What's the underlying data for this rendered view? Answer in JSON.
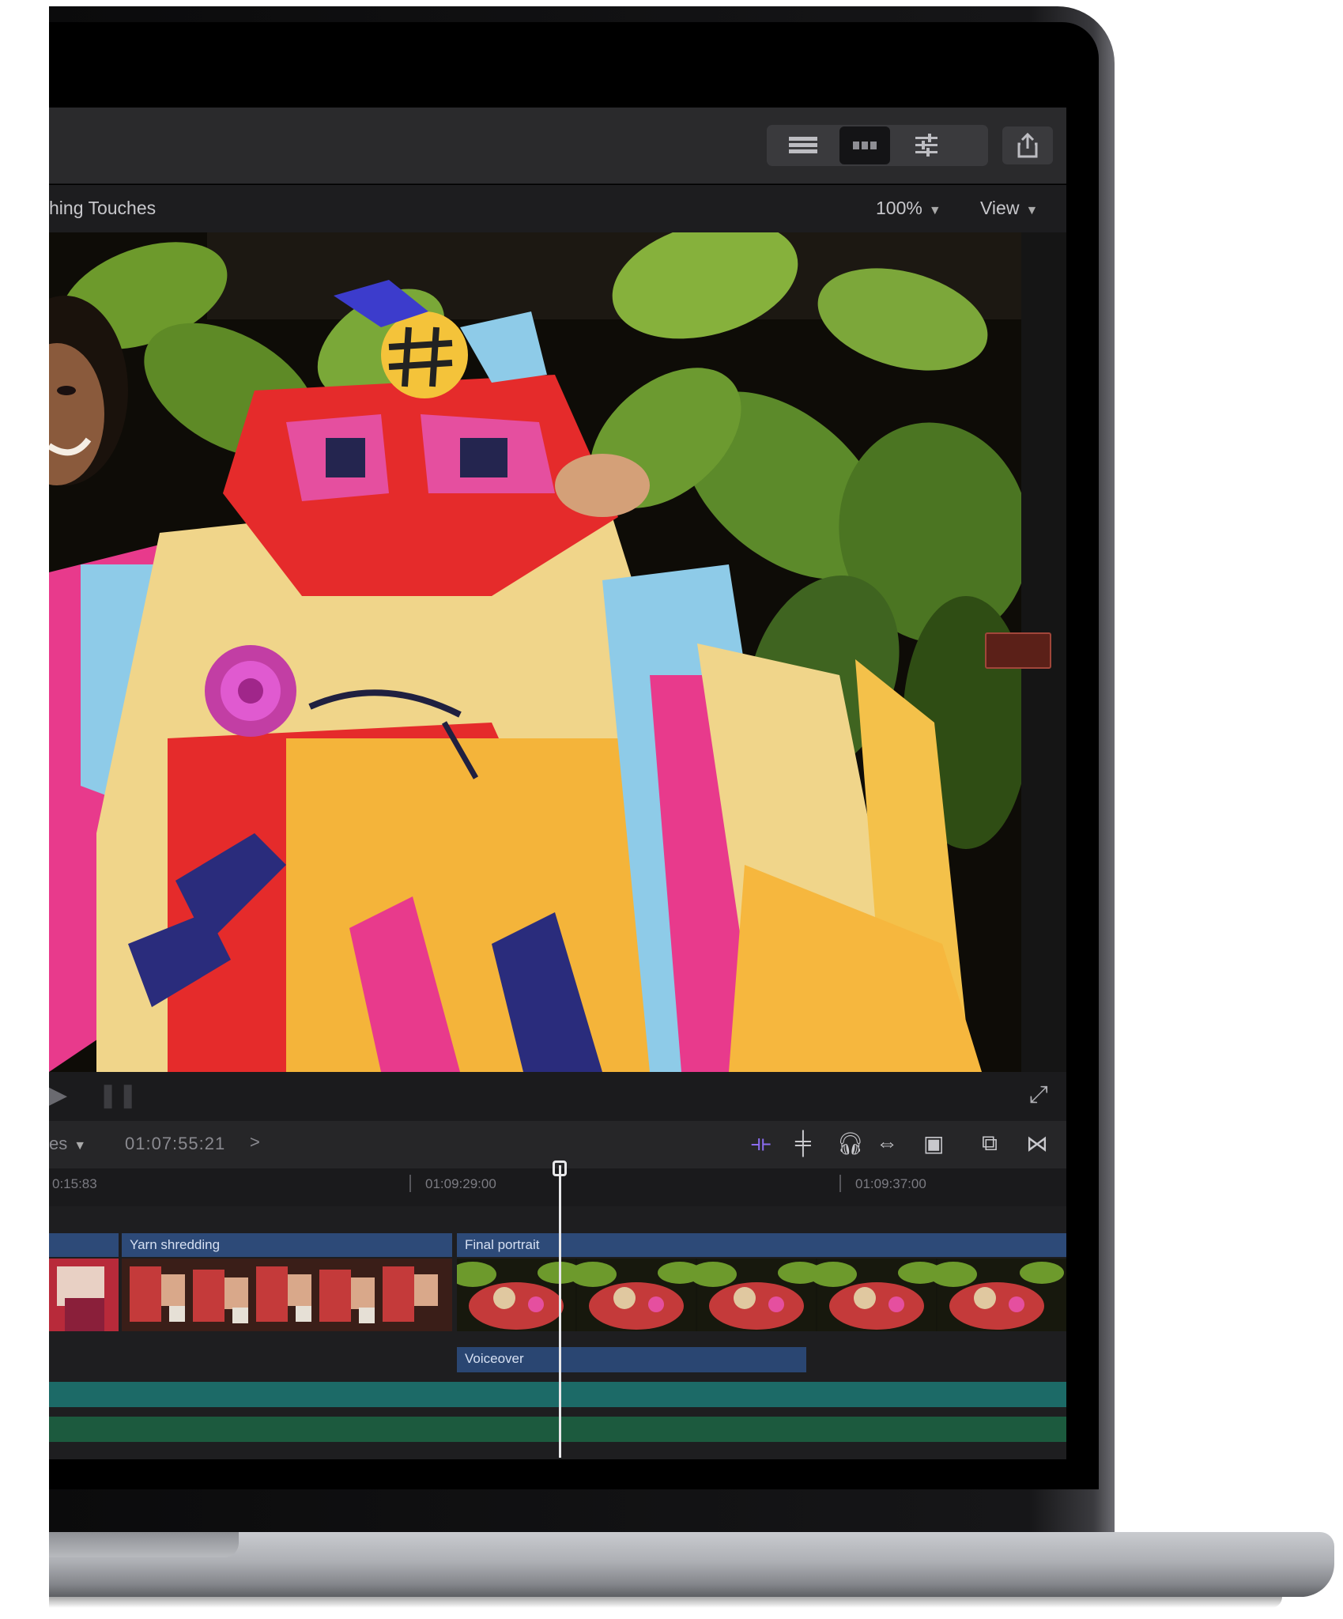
{
  "app": {
    "viewer": {
      "title": "hing Touches",
      "zoom_value": "100%",
      "view_menu_label": "View"
    },
    "timeline": {
      "project_label": "es",
      "timecode": "01:07:55:21",
      "ruler_labels": [
        "0:15:83",
        "01:09:29:00",
        "01:09:37:00"
      ],
      "clips": [
        {
          "title": "Yarn shredding"
        },
        {
          "title": "Final portrait"
        },
        {
          "title": "Voiceover"
        }
      ]
    }
  },
  "colors": {
    "clip_blue": "#2d4a78",
    "audio_teal": "#1c6a67",
    "audio_green": "#1c5a3e",
    "accent_purple": "#8b6cf0"
  },
  "icons": {
    "toolbar": [
      "list-view-icon",
      "filmstrip-view-icon",
      "inspector-sliders-icon",
      "share-icon"
    ],
    "timeline_tools": [
      "skimming-icon",
      "snapping-icon",
      "audio-headphones-icon",
      "solo-icon",
      "clip-appearance-icon",
      "timeline-index-icon",
      "trim-icon"
    ]
  }
}
